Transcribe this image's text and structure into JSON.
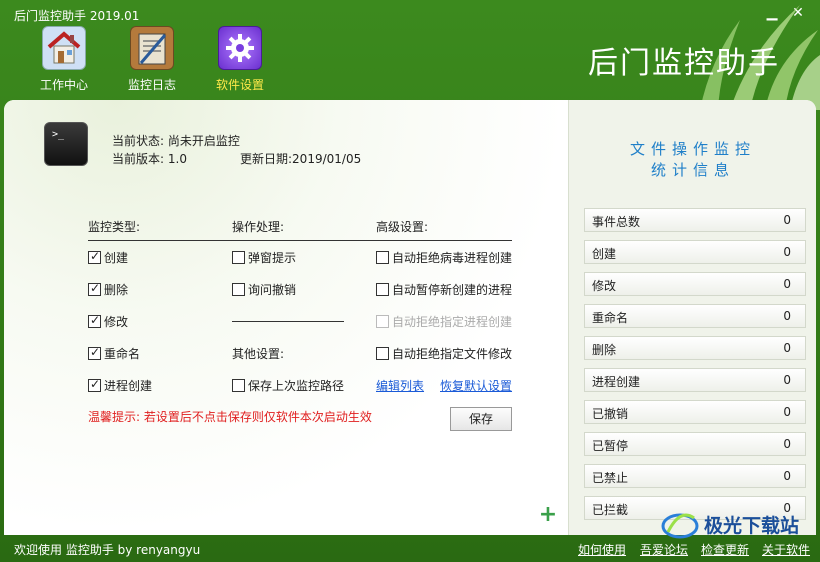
{
  "window": {
    "title": "后门监控助手 2019.01",
    "min_label": "▁",
    "close_label": "✕"
  },
  "toolbar": {
    "items": [
      {
        "label": "工作中心",
        "icon": "house-icon"
      },
      {
        "label": "监控日志",
        "icon": "log-clipboard-icon"
      },
      {
        "label": "软件设置",
        "icon": "gear-icon",
        "active": true
      }
    ]
  },
  "brand_title": "后门监控助手",
  "status": {
    "state_label": "当前状态:",
    "state_value": "尚未开启监控",
    "version_label": "当前版本:",
    "version_value": "1.0",
    "date_label": "更新日期:",
    "date_value": "2019/01/05"
  },
  "settings": {
    "monitor_type_header": "监控类型:",
    "action_header": "操作处理:",
    "advanced_header": "高级设置:",
    "monitor_types": [
      {
        "label": "创建",
        "checked": true
      },
      {
        "label": "删除",
        "checked": true
      },
      {
        "label": "修改",
        "checked": true
      },
      {
        "label": "重命名",
        "checked": true
      },
      {
        "label": "进程创建",
        "checked": true
      }
    ],
    "actions": [
      {
        "label": "弹窗提示",
        "checked": false
      },
      {
        "label": "询问撤销",
        "checked": false
      }
    ],
    "other_header": "其他设置:",
    "save_path": {
      "label": "保存上次监控路径",
      "checked": false
    },
    "advanced": [
      {
        "label": "自动拒绝病毒进程创建",
        "checked": false,
        "disabled": false
      },
      {
        "label": "自动暂停新创建的进程",
        "checked": false,
        "disabled": false
      },
      {
        "label": "自动拒绝指定进程创建",
        "checked": false,
        "disabled": true
      },
      {
        "label": "自动拒绝指定文件修改",
        "checked": false,
        "disabled": false
      }
    ],
    "edit_list_link": "编辑列表",
    "restore_defaults_link": "恢复默认设置",
    "warning": "温馨提示: 若设置后不点击保存则仅软件本次启动生效",
    "save_button": "保存"
  },
  "stats": {
    "title_line1": "文件操作监控",
    "title_line2": "统计信息",
    "rows": [
      {
        "label": "事件总数",
        "value": "0"
      },
      {
        "label": "创建",
        "value": "0"
      },
      {
        "label": "修改",
        "value": "0"
      },
      {
        "label": "重命名",
        "value": "0"
      },
      {
        "label": "删除",
        "value": "0"
      },
      {
        "label": "进程创建",
        "value": "0"
      },
      {
        "label": "已撤销",
        "value": "0"
      },
      {
        "label": "已暂停",
        "value": "0"
      },
      {
        "label": "已禁止",
        "value": "0"
      },
      {
        "label": "已拦截",
        "value": "0"
      }
    ]
  },
  "statusbar": {
    "welcome": "欢迎使用 监控助手  by  renyangyu",
    "links": [
      "如何使用",
      "吾爱论坛",
      "检查更新",
      "关于软件"
    ]
  },
  "watermark": "极光下载站",
  "colors": {
    "green_frame": "#3c8a1e",
    "stats_title": "#1f7fc9",
    "warning": "#e02020",
    "link": "#1a5ad7",
    "active_tab": "#ffe94a"
  }
}
